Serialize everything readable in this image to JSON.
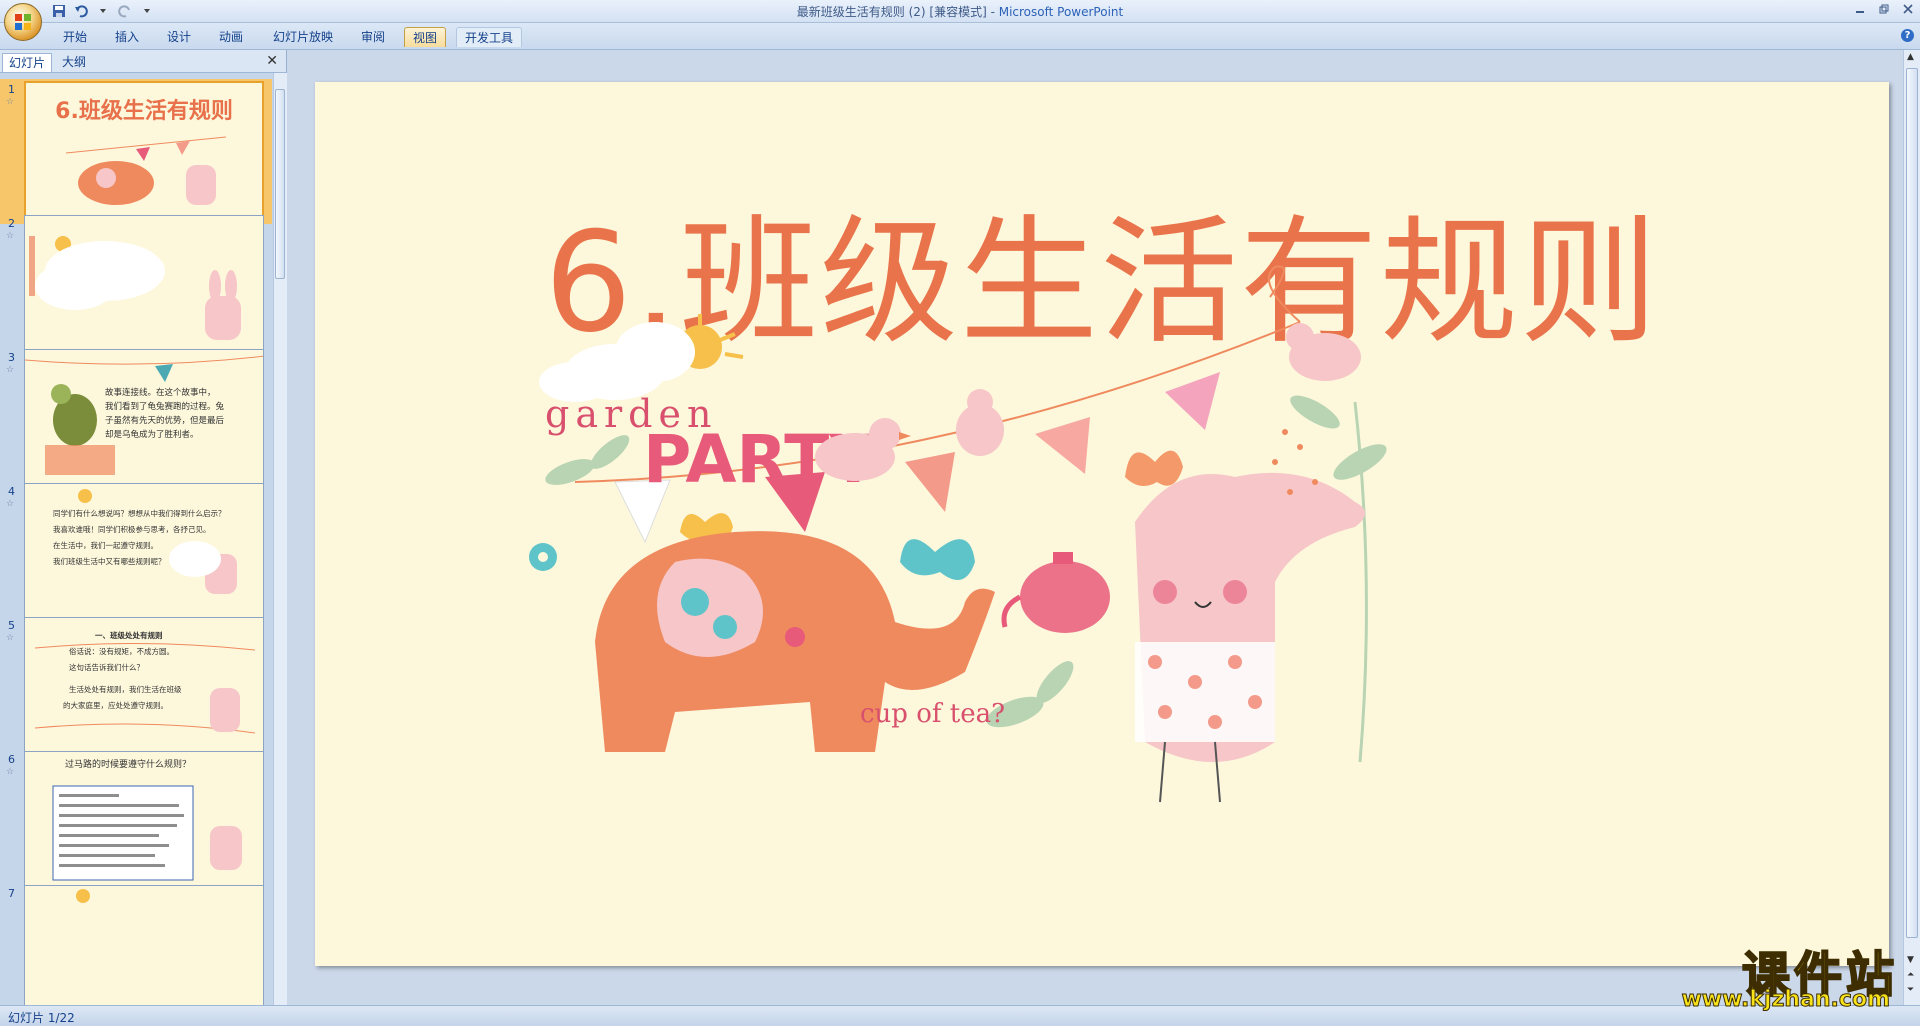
{
  "window": {
    "title_doc": "最新班级生活有规则 (2) [兼容模式] - ",
    "title_app": "Microsoft PowerPoint"
  },
  "ribbon": {
    "tabs": [
      {
        "label": "开始"
      },
      {
        "label": "插入"
      },
      {
        "label": "设计"
      },
      {
        "label": "动画"
      },
      {
        "label": "幻灯片放映"
      },
      {
        "label": "审阅"
      },
      {
        "label": "视图"
      },
      {
        "label": "开发工具"
      }
    ]
  },
  "panel": {
    "tab_slides": "幻灯片",
    "tab_outline": "大纲",
    "close": "✕"
  },
  "thumbs": [
    {
      "num": "1",
      "title": "6.班级生活有规则"
    },
    {
      "num": "2"
    },
    {
      "num": "3",
      "lines": [
        "故事连接线。在这个故事中，",
        "我们看到了龟兔赛跑的过程。兔",
        "子虽然有先天的优势，但是最后",
        "却是乌龟成为了胜利者。"
      ]
    },
    {
      "num": "4",
      "lines": [
        "同学们有什么想说吗？想想从中我们得到什么启示？",
        "我喜欢谁哦！同学们积极参与思考，各抒己见。",
        "在生活中，我们一起遵守规则。",
        "我们班级生活中又有哪些规则呢？"
      ]
    },
    {
      "num": "5",
      "lines": [
        "一、班级处处有规则",
        "俗话说：没有规矩，不成方圆。",
        "这句话告诉我们什么？",
        "生活处处有规则，我们生活在班级",
        "的大家庭里，应处处遵守规则。"
      ]
    },
    {
      "num": "6",
      "lines": [
        "过马路的时候要遵守什么规则？"
      ]
    },
    {
      "num": "7"
    }
  ],
  "slide": {
    "title": "6.班级生活有规则",
    "art_text_1": "garden",
    "art_text_2": "PARTY",
    "art_text_3": "cup of tea?"
  },
  "status": {
    "text": "幻灯片 1/22"
  },
  "watermark": {
    "main": "课件站",
    "url": "www.kjzhan.com"
  },
  "colors": {
    "title": "#e9744c",
    "slide_bg": "#fdf8dc",
    "elephant": "#ef8a5f",
    "bunny": "#f6c6c8"
  }
}
